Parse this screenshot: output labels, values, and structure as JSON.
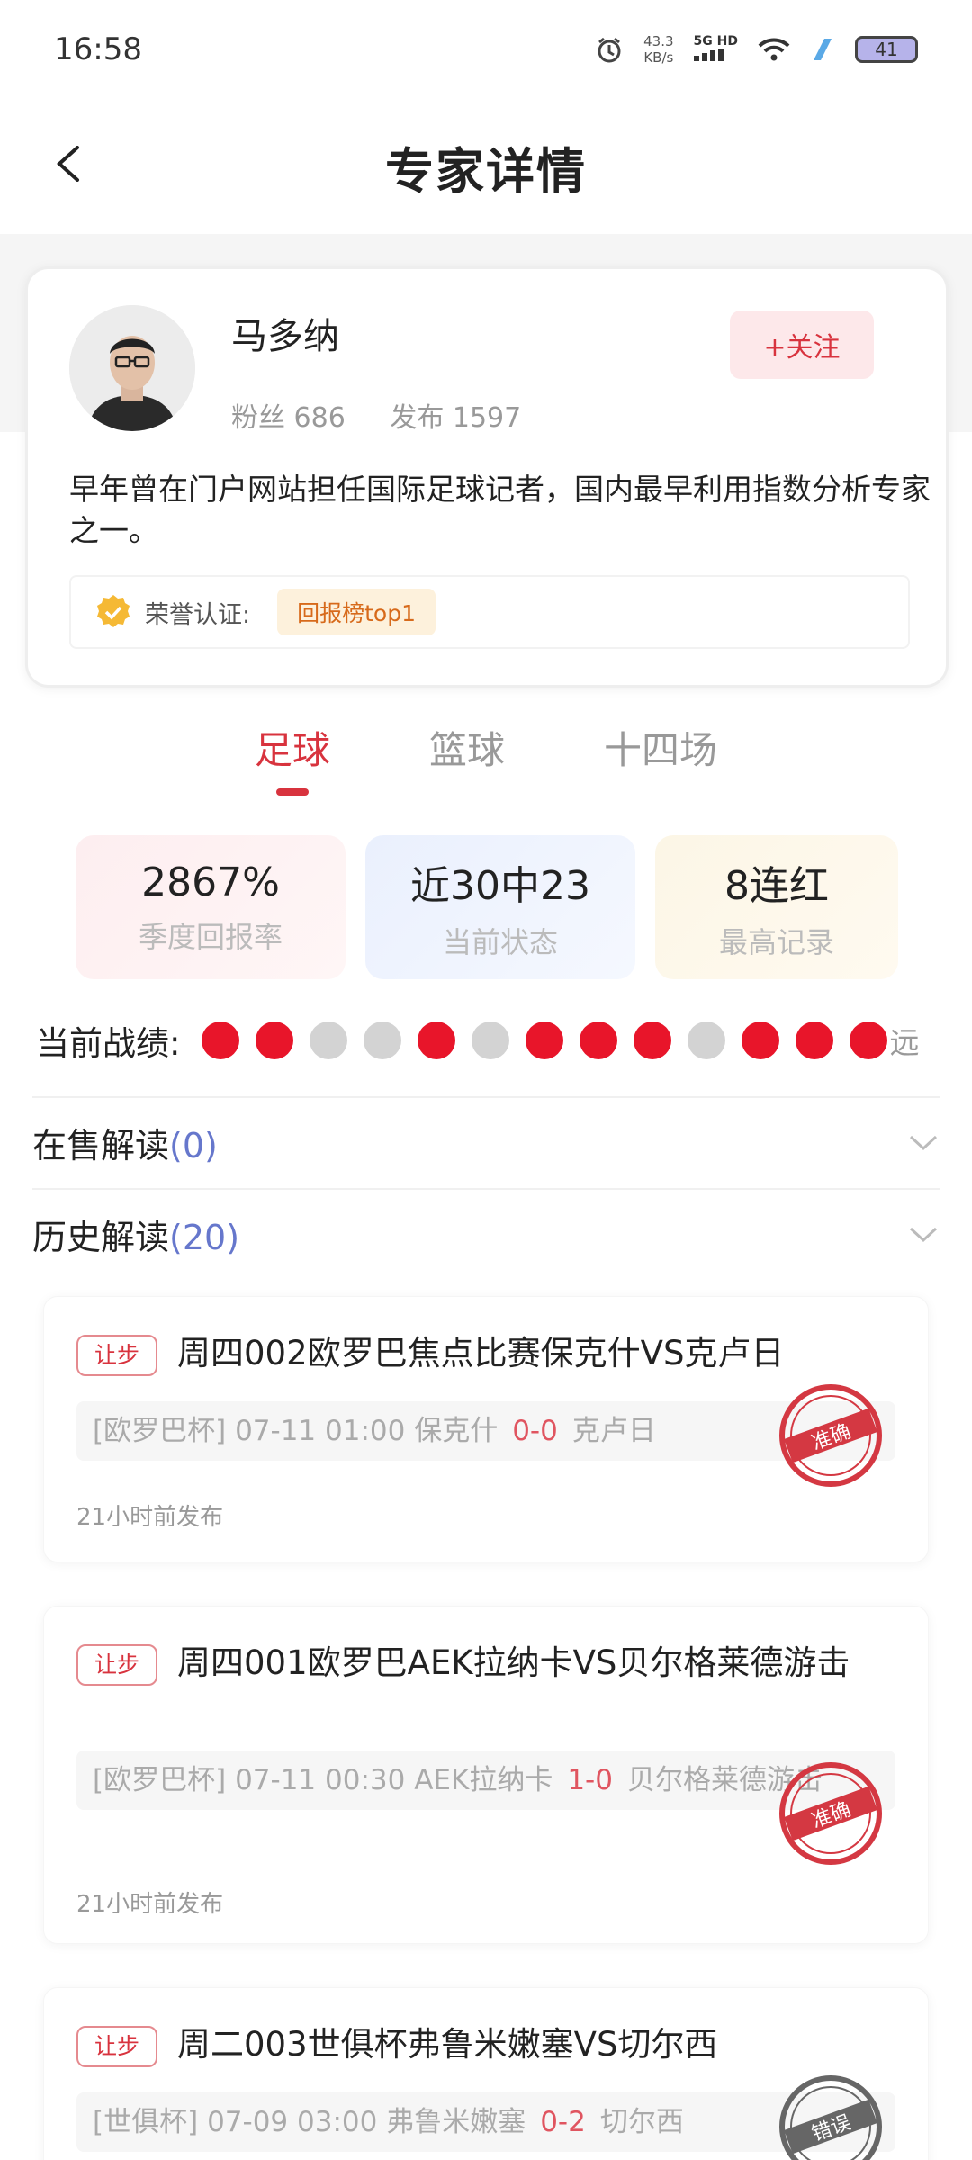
{
  "status_bar": {
    "time": "16:58",
    "net_speed": "43.3",
    "net_unit": "KB/s",
    "signal": "5G HD",
    "battery": "41"
  },
  "header": {
    "title": "专家详情"
  },
  "expert": {
    "name": "马多纳",
    "fans": "粉丝 686",
    "posts": "发布 1597",
    "follow": "+关注",
    "bio": "早年曾在门户网站担任国际足球记者，国内最早利用指数分析专家之一。",
    "honor_label": "荣誉认证:",
    "honor_tag": "回报榜top1"
  },
  "sport_tabs": [
    "足球",
    "篮球",
    "十四场"
  ],
  "stats": [
    {
      "value": "2867%",
      "label": "季度回报率"
    },
    {
      "value": "近30中23",
      "label": "当前状态"
    },
    {
      "value": "8连红",
      "label": "最高记录"
    }
  ],
  "record": {
    "label": "当前战绩:",
    "results": [
      "win",
      "win",
      "loss",
      "loss",
      "win",
      "loss",
      "win",
      "win",
      "win",
      "loss",
      "win",
      "win",
      "win"
    ],
    "far": "远"
  },
  "sections": {
    "on_sale": {
      "label": "在售解读",
      "count": "(0)"
    },
    "history": {
      "label": "历史解读",
      "count": "(20)"
    }
  },
  "matches": [
    {
      "tag": "让步",
      "title": "周四002欧罗巴焦点比赛保克什VS克卢日",
      "league": "[欧罗巴杯]",
      "time": "07-11 01:00",
      "home": "保克什",
      "score": "0-0",
      "away": "克卢日",
      "posted": "21小时前发布",
      "result": "准确"
    },
    {
      "tag": "让步",
      "title": "周四001欧罗巴AEK拉纳卡VS贝尔格莱德游击",
      "league": "[欧罗巴杯]",
      "time": "07-11 00:30",
      "home": "AEK拉纳卡",
      "score": "1-0",
      "away": "贝尔格莱德游击",
      "posted": "21小时前发布",
      "result": "准确"
    },
    {
      "tag": "让步",
      "title": "周二003世俱杯弗鲁米嫩塞VS切尔西",
      "league": "[世俱杯]",
      "time": "07-09 03:00",
      "home": "弗鲁米嫩塞",
      "score": "0-2",
      "away": "切尔西",
      "posted": "",
      "result": "错误"
    }
  ],
  "colors": {
    "accent": "#d8333e",
    "win_dot": "#e8152a",
    "loss_dot": "#d3d3d3"
  }
}
